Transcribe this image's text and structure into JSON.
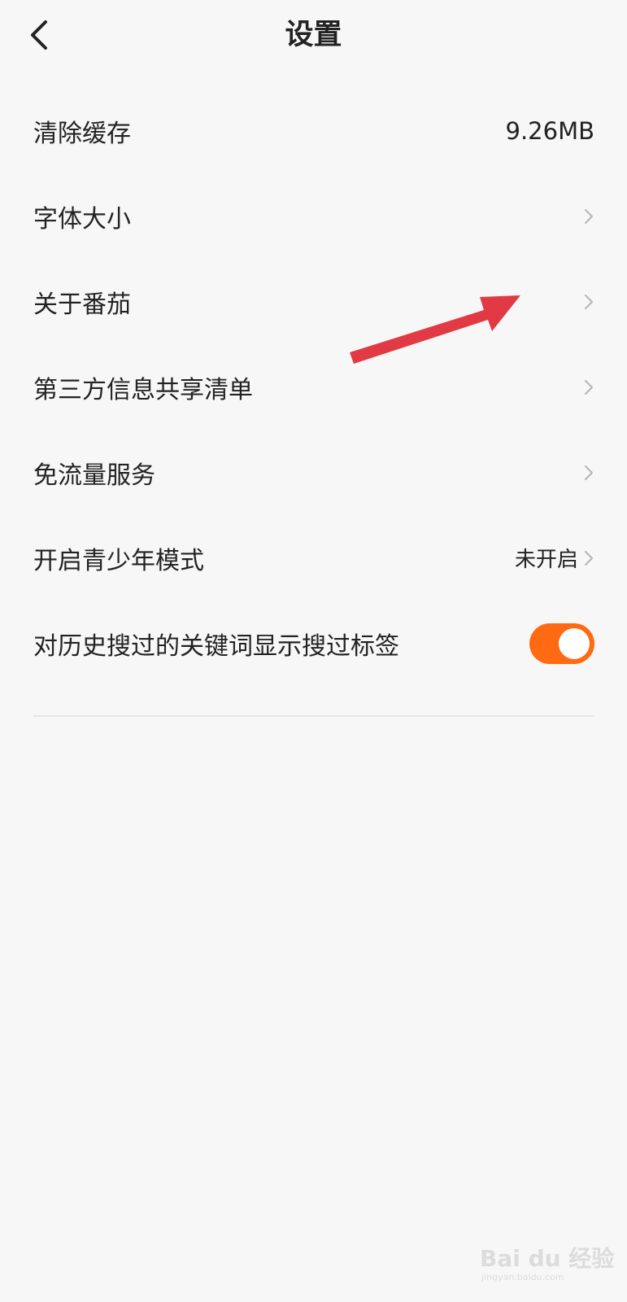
{
  "header": {
    "title": "设置"
  },
  "settings": {
    "items": [
      {
        "label": "清除缓存",
        "value": "9.26MB"
      },
      {
        "label": "字体大小"
      },
      {
        "label": "关于番茄"
      },
      {
        "label": "第三方信息共享清单"
      },
      {
        "label": "免流量服务"
      },
      {
        "label": "开启青少年模式",
        "value": "未开启"
      },
      {
        "label": "对历史搜过的关键词显示搜过标签",
        "toggle_on": true
      }
    ]
  },
  "colors": {
    "accent": "#ff6a12",
    "annotation_arrow": "#e23a44",
    "background": "#f7f7f7"
  },
  "watermark": {
    "text": "Bai du 经验",
    "sub": "jingyan.baidu.com"
  }
}
